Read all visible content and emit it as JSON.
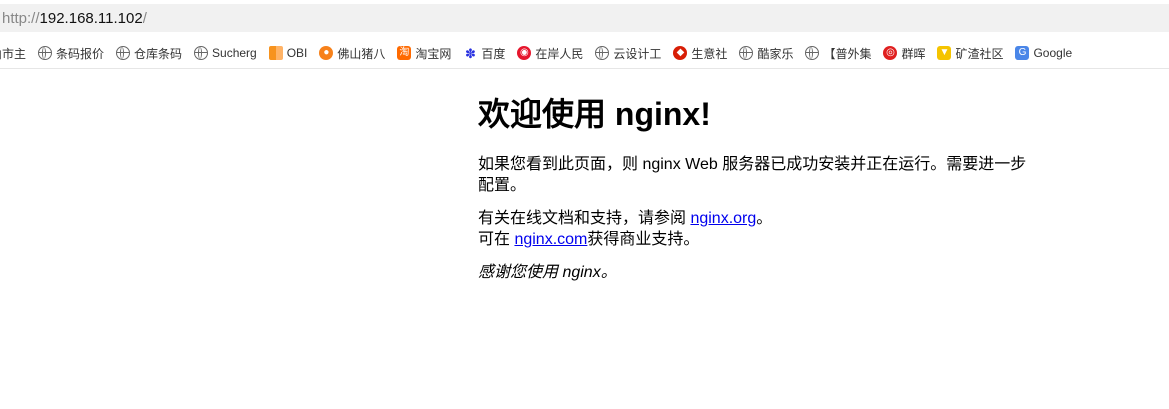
{
  "address_bar": {
    "scheme": "http://",
    "host": "192.168.11.102",
    "path": "/"
  },
  "bookmarks": [
    {
      "icon": "none",
      "label": "山市主"
    },
    {
      "icon": "globe-icon",
      "label": "条码报价"
    },
    {
      "icon": "globe-icon",
      "label": "仓库条码"
    },
    {
      "icon": "globe-icon",
      "label": "Sucherg"
    },
    {
      "icon": "obi-icon",
      "label": "OBI"
    },
    {
      "icon": "pig-icon",
      "label": "佛山猪八"
    },
    {
      "icon": "taobao-icon",
      "label": "淘宝网"
    },
    {
      "icon": "baidu-icon",
      "label": "百度"
    },
    {
      "icon": "weibo-icon",
      "label": "在岸人民"
    },
    {
      "icon": "globe-icon",
      "label": "云设计工"
    },
    {
      "icon": "shengyi-icon",
      "label": "生意社"
    },
    {
      "icon": "globe-icon",
      "label": "酷家乐"
    },
    {
      "icon": "globe-icon",
      "label": "【普外集"
    },
    {
      "icon": "red-circle-icon",
      "label": "群晖"
    },
    {
      "icon": "trophy-icon",
      "label": "矿渣社区"
    },
    {
      "icon": "google-translate-icon",
      "label": "Google"
    }
  ],
  "page": {
    "title": "欢迎使用 nginx!",
    "para1": "如果您看到此页面，则 nginx Web 服务器已成功安装并正在运行。需要进一步配置。",
    "para2_prefix": "有关在线文档和支持，请参阅 ",
    "para2_link": "nginx.org",
    "para2_suffix": "。",
    "para3_prefix": "可在 ",
    "para3_link": "nginx.com",
    "para3_suffix": "获得商业支持。",
    "thanks": "感谢您使用 nginx。"
  }
}
